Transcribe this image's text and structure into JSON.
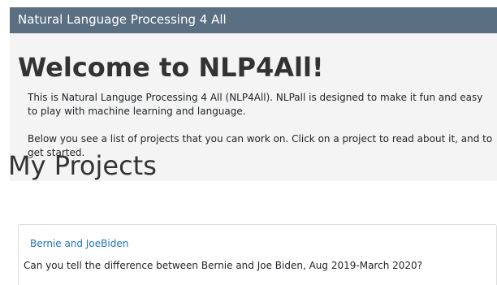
{
  "navbar": {
    "brand": "Natural Language Processing 4 All"
  },
  "welcome": {
    "title": "Welcome to NLP4All!",
    "paragraph_1": "This is Natural Languge Processing 4 All (NLP4All). NLPall is designed to make it fun and easy to play with machine learning and language.",
    "paragraph_2": "Below you see a list of projects that you can work on. Click on a project to read about it, and to get started."
  },
  "projects": {
    "heading": "My Projects",
    "items": [
      {
        "title": "Bernie and JoeBiden",
        "description": "Can you tell the difference between Bernie and Joe Biden, Aug 2019-March 2020?"
      }
    ]
  },
  "colors": {
    "navbar_bg": "#5b6f82",
    "jumbotron_bg": "#f4f4f4",
    "link": "#1e73be"
  }
}
